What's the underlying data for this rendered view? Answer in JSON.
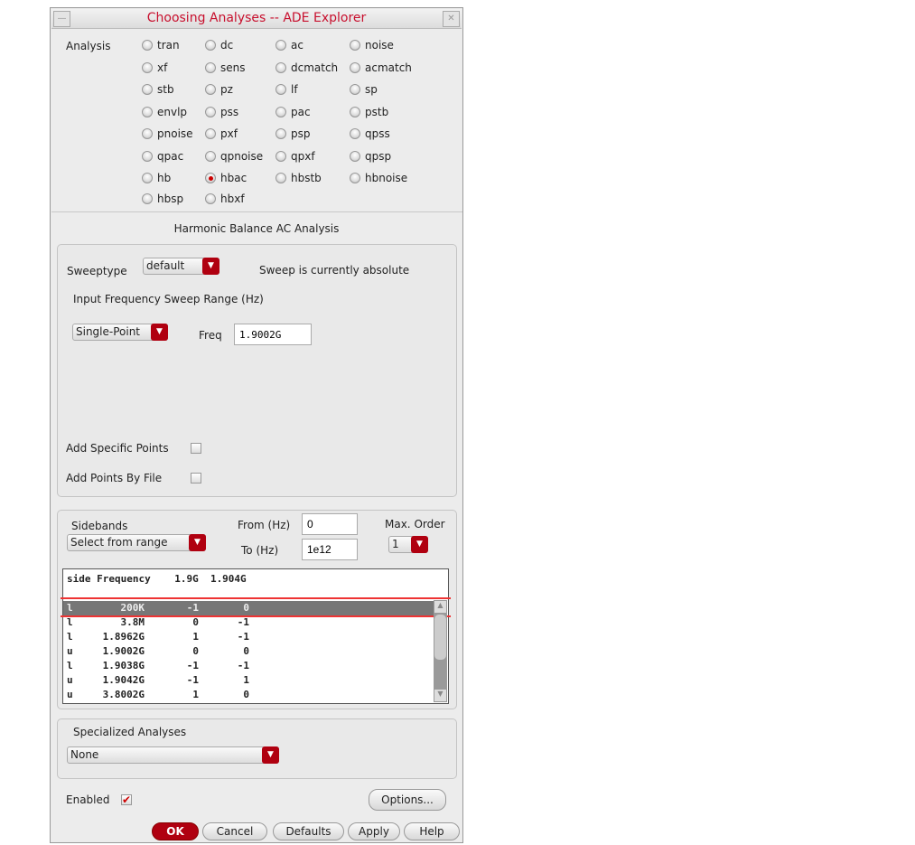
{
  "window": {
    "title": "Choosing Analyses -- ADE Explorer",
    "minimize_icon": "minimize-icon",
    "close_icon": "close-icon"
  },
  "analysis": {
    "label": "Analysis",
    "selected": "hbac",
    "options": [
      "tran",
      "dc",
      "ac",
      "noise",
      "xf",
      "sens",
      "dcmatch",
      "acmatch",
      "stb",
      "pz",
      "lf",
      "sp",
      "envlp",
      "pss",
      "pac",
      "pstb",
      "pnoise",
      "pxf",
      "psp",
      "qpss",
      "qpac",
      "qpnoise",
      "qpxf",
      "qpsp",
      "hb",
      "hbac",
      "hbstb",
      "hbnoise",
      "hbsp",
      "hbxf"
    ]
  },
  "section_title": "Harmonic Balance AC Analysis",
  "sweep": {
    "sweeptype_label": "Sweeptype",
    "sweeptype_value": "default",
    "status": "Sweep is currently absolute",
    "range_label": "Input Frequency Sweep Range (Hz)",
    "range_type": "Single-Point",
    "freq_label": "Freq",
    "freq_value": "1.9002G",
    "add_points_label": "Add Specific Points",
    "add_points_file_label": "Add Points By File"
  },
  "sidebands": {
    "label": "Sidebands",
    "mode": "Select from range",
    "from_label": "From (Hz)",
    "from_value": "0",
    "to_label": "To (Hz)",
    "to_value": "1e12",
    "max_order_label": "Max. Order",
    "max_order_value": "1",
    "header": "side Frequency    1.9G  1.904G",
    "rows": [
      {
        "side": "l",
        "freq": "200K",
        "a": "-1",
        "b": "0"
      },
      {
        "side": "l",
        "freq": "3.8M",
        "a": "0",
        "b": "-1"
      },
      {
        "side": "l",
        "freq": "1.8962G",
        "a": "1",
        "b": "-1"
      },
      {
        "side": "u",
        "freq": "1.9002G",
        "a": "0",
        "b": "0"
      },
      {
        "side": "l",
        "freq": "1.9038G",
        "a": "-1",
        "b": "-1"
      },
      {
        "side": "u",
        "freq": "1.9042G",
        "a": "-1",
        "b": "1"
      },
      {
        "side": "u",
        "freq": "3.8002G",
        "a": "1",
        "b": "0"
      }
    ]
  },
  "specialized": {
    "label": "Specialized Analyses",
    "value": "None"
  },
  "enabled": {
    "label": "Enabled",
    "checked": true
  },
  "buttons": {
    "options": "Options...",
    "ok": "OK",
    "cancel": "Cancel",
    "defaults": "Defaults",
    "apply": "Apply",
    "help": "Help"
  }
}
